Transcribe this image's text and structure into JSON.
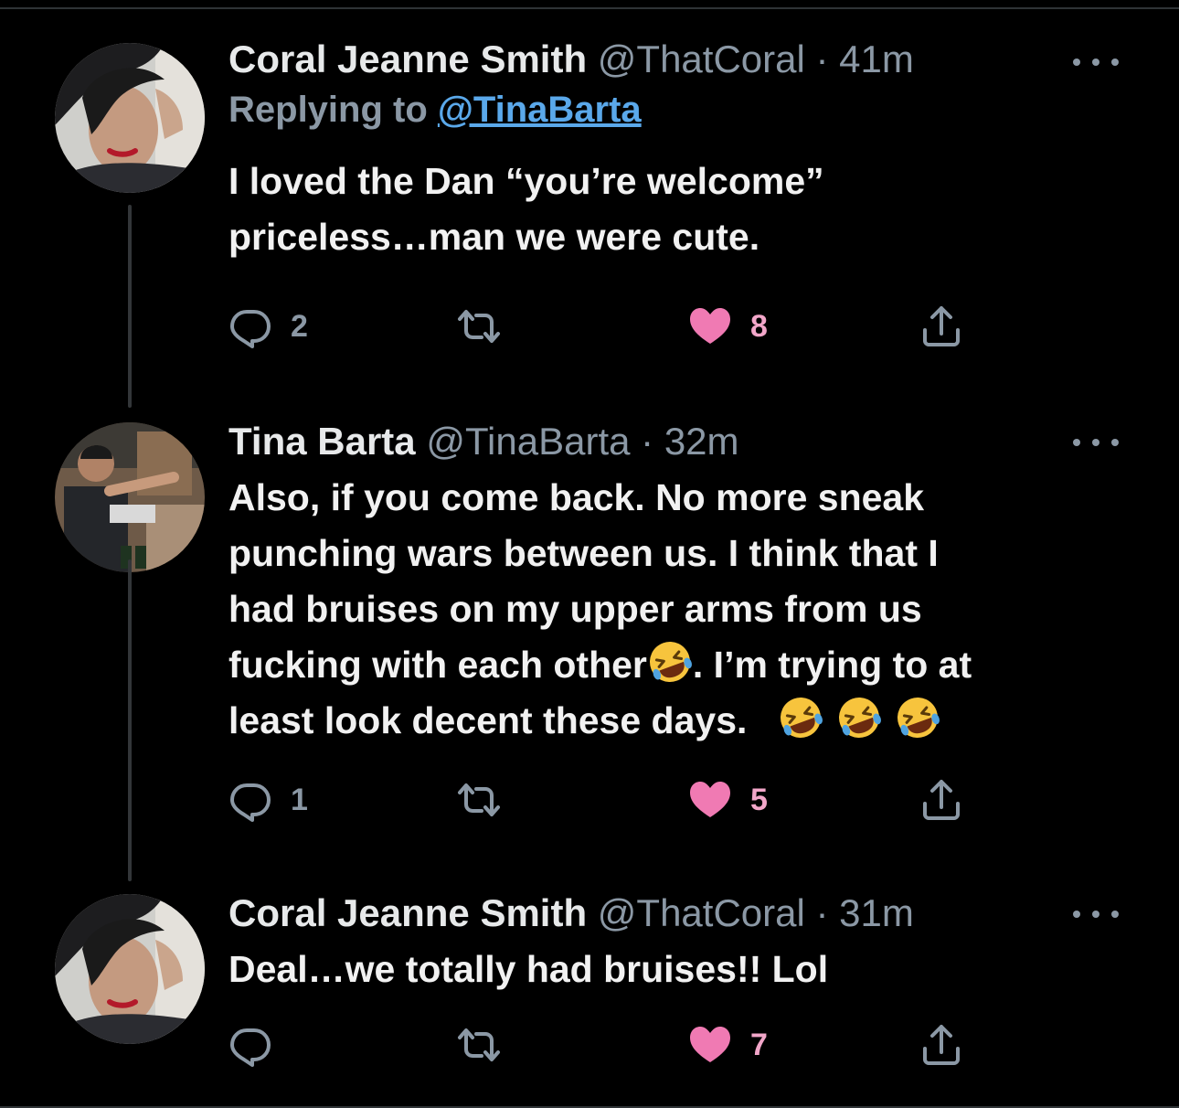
{
  "tweets": [
    {
      "name": "Coral Jeanne Smith",
      "handle": "@ThatCoral",
      "dot": "·",
      "time": "41m",
      "replying_prefix": "Replying to ",
      "replying_mention": "@TinaBarta",
      "body_line1": "I loved the Dan “you’re welcome”",
      "body_line2": "priceless…man we were cute.",
      "replies": "2",
      "retweets": "",
      "likes": "8"
    },
    {
      "name": "Tina Barta",
      "handle": "@TinaBarta",
      "dot": "·",
      "time": "32m",
      "body_line1": "Also, if you come back.  No more sneak",
      "body_line2": "punching wars between us.  I think that I",
      "body_line3": "had bruises on my upper arms from us",
      "body_line4a": "fucking with each other",
      "body_line4b": ". I’m trying to at",
      "body_line5": "least look decent these days.",
      "replies": "1",
      "retweets": "",
      "likes": "5"
    },
    {
      "name": "Coral Jeanne Smith",
      "handle": "@ThatCoral",
      "dot": "·",
      "time": "31m",
      "body_line1": "Deal…we totally had bruises!! Lol",
      "replies": "",
      "retweets": "",
      "likes": "7"
    }
  ],
  "icons": {
    "reply": "reply-icon",
    "retweet": "retweet-icon",
    "like": "heart-icon",
    "share": "share-icon",
    "more": "more-icon",
    "emoji": "rolling-on-floor-laughing-emoji"
  },
  "colors": {
    "background": "#000000",
    "text": "#e7e9ea",
    "muted": "#8b98a5",
    "link": "#5aa8ea",
    "like": "#f2a6c9"
  }
}
